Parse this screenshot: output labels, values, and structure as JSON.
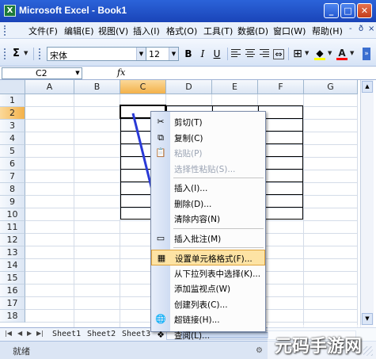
{
  "window": {
    "title": "Microsoft Excel - Book1",
    "minimize": "_",
    "maximize": "□",
    "close": "✕"
  },
  "menu": [
    {
      "label": "文件(F)"
    },
    {
      "label": "编辑(E)"
    },
    {
      "label": "视图(V)"
    },
    {
      "label": "插入(I)"
    },
    {
      "label": "格式(O)"
    },
    {
      "label": "工具(T)"
    },
    {
      "label": "数据(D)"
    },
    {
      "label": "窗口(W)"
    },
    {
      "label": "帮助(H)"
    },
    {
      "label": "-"
    },
    {
      "label": "ð"
    },
    {
      "label": "×"
    }
  ],
  "toolbar": {
    "sigma": "Σ",
    "font_name": "宋体",
    "font_size": "12",
    "bold": "B",
    "italic": "I",
    "underline": "U",
    "font_color_letter": "A",
    "fill_color": "#ffff00",
    "font_color": "#ff0000"
  },
  "formula_bar": {
    "name_box": "C2",
    "fx": "fx"
  },
  "columns": [
    "A",
    "B",
    "C",
    "D",
    "E",
    "F",
    "G"
  ],
  "selected_column": "C",
  "rows": [
    "1",
    "2",
    "3",
    "4",
    "5",
    "6",
    "7",
    "8",
    "9",
    "10",
    "11",
    "12",
    "13",
    "14",
    "15",
    "16",
    "17",
    "18"
  ],
  "selected_row": "2",
  "context_menu": [
    {
      "label": "剪切(T)",
      "icon": "scissors-icon",
      "glyph": "✂",
      "disabled": false
    },
    {
      "label": "复制(C)",
      "icon": "copy-icon",
      "glyph": "⧉",
      "disabled": false
    },
    {
      "label": "粘贴(P)",
      "icon": "paste-icon",
      "glyph": "📋",
      "disabled": true
    },
    {
      "label": "选择性粘贴(S)...",
      "icon": "",
      "glyph": "",
      "disabled": true
    },
    {
      "separator": true
    },
    {
      "label": "插入(I)...",
      "icon": "",
      "glyph": "",
      "disabled": false
    },
    {
      "label": "删除(D)...",
      "icon": "",
      "glyph": "",
      "disabled": false
    },
    {
      "label": "清除内容(N)",
      "icon": "",
      "glyph": "",
      "disabled": false
    },
    {
      "separator": true
    },
    {
      "label": "插入批注(M)",
      "icon": "comment-icon",
      "glyph": "▭",
      "disabled": false
    },
    {
      "separator": true
    },
    {
      "label": "设置单元格格式(F)...",
      "icon": "format-cells-icon",
      "glyph": "▦",
      "disabled": false,
      "highlight": true
    },
    {
      "label": "从下拉列表中选择(K)...",
      "icon": "",
      "glyph": "",
      "disabled": false
    },
    {
      "label": "添加监视点(W)",
      "icon": "",
      "glyph": "",
      "disabled": false
    },
    {
      "label": "创建列表(C)...",
      "icon": "",
      "glyph": "",
      "disabled": false
    },
    {
      "label": "超链接(H)...",
      "icon": "hyperlink-icon",
      "glyph": "🌐",
      "disabled": false
    },
    {
      "label": "查阅(L)...",
      "icon": "research-icon",
      "glyph": "❖",
      "disabled": false
    }
  ],
  "sheets": [
    "Sheet1",
    "Sheet2",
    "Sheet3"
  ],
  "sheet_nav": [
    "|◀",
    "◀",
    "▶",
    "▶|"
  ],
  "status": "就绪",
  "watermark": "元码手游网",
  "accent": {
    "highlight": "#fde3a4",
    "arrow": "#2a3ad6"
  }
}
